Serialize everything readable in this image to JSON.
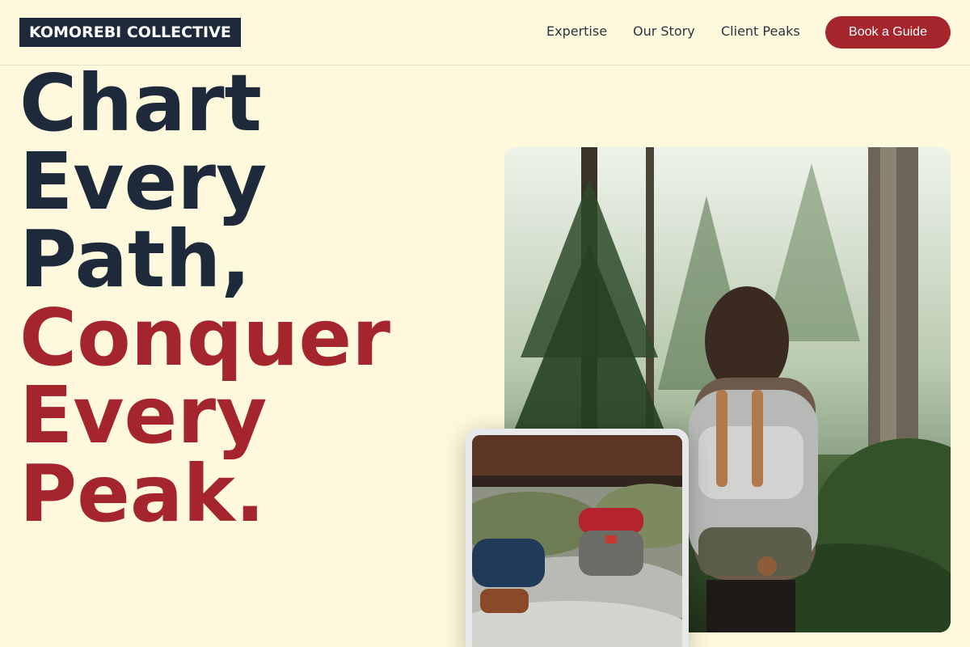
{
  "brand": {
    "name": "KOMOREBI COLLECTIVE"
  },
  "nav": {
    "links": [
      {
        "label": "Expertise"
      },
      {
        "label": "Our Story"
      },
      {
        "label": "Client Peaks"
      }
    ],
    "cta_label": "Book a Guide"
  },
  "hero": {
    "title_lines_dark": [
      "Chart",
      "Every",
      "Path,"
    ],
    "title_lines_accent": [
      "Conquer",
      "Every",
      "Peak."
    ]
  },
  "images": {
    "main": {
      "description": "hiker-with-backpack-in-forest"
    },
    "secondary": {
      "description": "backpacks-on-rocks"
    }
  },
  "colors": {
    "background": "#fef8dc",
    "navy": "#1e293b",
    "accent": "#a4262c"
  }
}
